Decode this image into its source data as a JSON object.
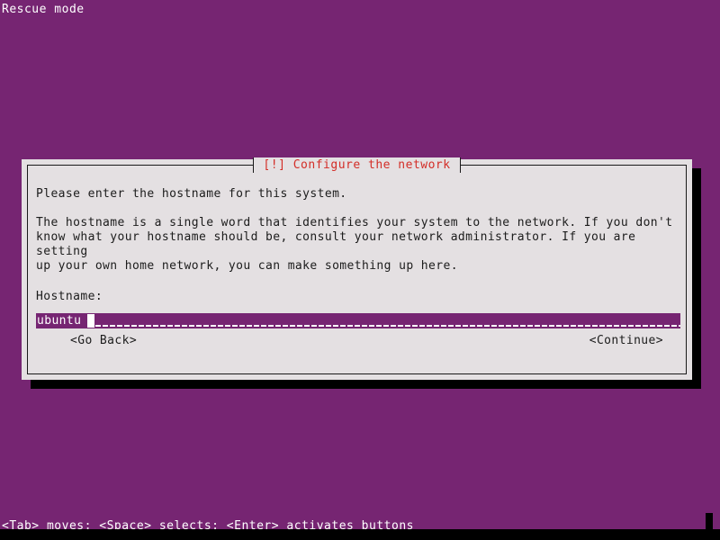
{
  "screen": {
    "background_color": "#762572",
    "mode_label": "Rescue mode"
  },
  "dialog": {
    "title": "[!] Configure the network",
    "title_color": "#d32d27",
    "background_color": "#e4e0e2",
    "intro_text": "Please enter the hostname for this system.",
    "detail_text": "The hostname is a single word that identifies your system to the network. If you don't\nknow what your hostname should be, consult your network administrator. If you are setting\nup your own home network, you can make something up here.",
    "field": {
      "label": "Hostname:",
      "value": "ubuntu",
      "field_background_color": "#762572",
      "field_text_color": "#ffffff"
    },
    "buttons": {
      "back_label": "<Go Back>",
      "continue_label": "<Continue>"
    }
  },
  "footer": {
    "help_text": "<Tab> moves; <Space> selects; <Enter> activates buttons"
  }
}
